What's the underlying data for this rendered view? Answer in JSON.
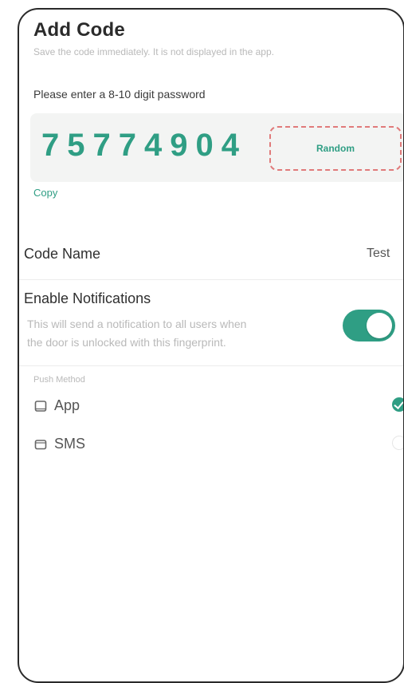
{
  "header": {
    "title": "Add Code",
    "subtitle": "Save the code immediately. It is not displayed in the app."
  },
  "password": {
    "prompt": "Please enter a 8-10 digit password",
    "code": "75774904",
    "random_label": "Random",
    "copy_label": "Copy"
  },
  "code_name": {
    "label": "Code Name",
    "value": "Test"
  },
  "notifications": {
    "title": "Enable Notifications",
    "description_line1": "This will send a notification to all users when",
    "description_line2": "the door is unlocked with this fingerprint.",
    "enabled": true
  },
  "push_method": {
    "label": "Push Method",
    "options": [
      {
        "label": "App",
        "icon": "app-icon",
        "selected": true
      },
      {
        "label": "SMS",
        "icon": "sms-icon",
        "selected": false
      }
    ]
  },
  "colors": {
    "accent": "#2f9e84",
    "random_dash": "#e07a7a",
    "muted_text": "#b9b9b9",
    "code_box_bg": "#f3f4f3"
  }
}
